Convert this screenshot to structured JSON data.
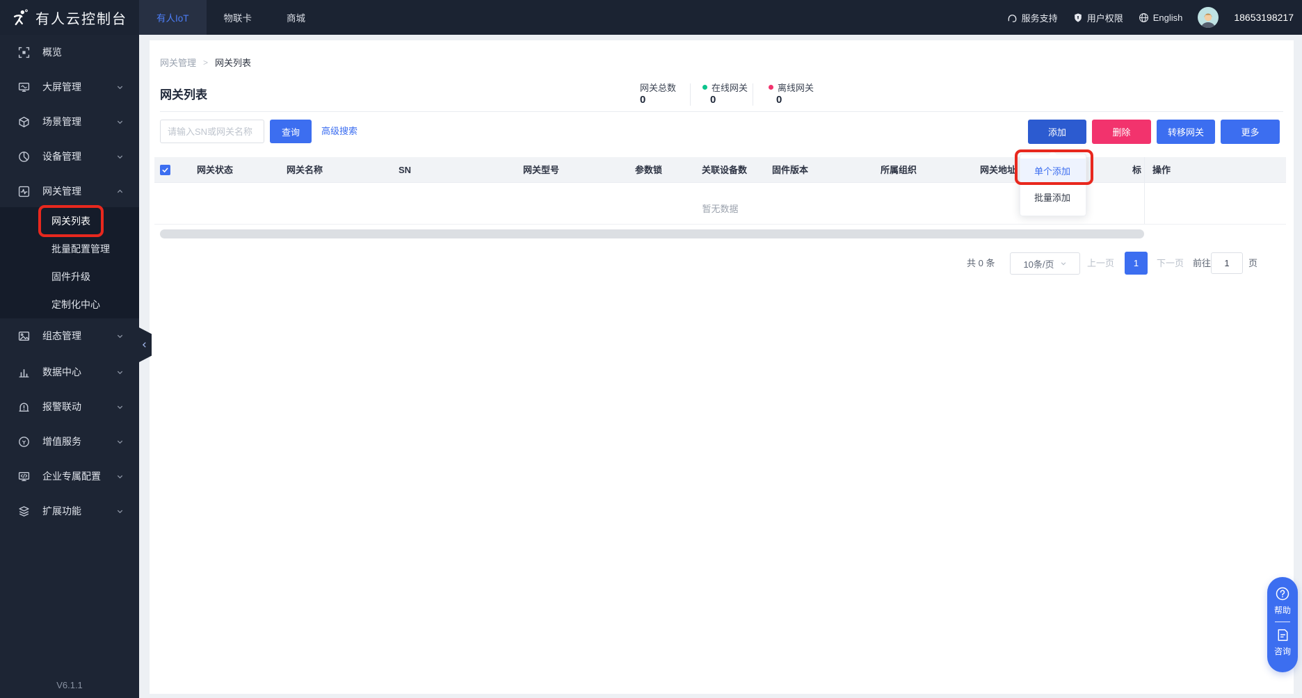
{
  "topbar": {
    "title": "有人云控制台",
    "tabs": {
      "iot": "有人IoT",
      "sim": "物联卡",
      "mall": "商城"
    },
    "support": "服务支持",
    "permission": "用户权限",
    "language": "English",
    "phone": "18653198217"
  },
  "sidebar": {
    "overview": "概览",
    "screen": "大屏管理",
    "scene": "场景管理",
    "device": "设备管理",
    "gateway": "网关管理",
    "gateway_sub": {
      "list": "网关列表",
      "batch": "批量配置管理",
      "firmware": "固件升级",
      "custom": "定制化中心"
    },
    "config": "组态管理",
    "data": "数据中心",
    "alarm": "报警联动",
    "value": "增值服务",
    "enterprise": "企业专属配置",
    "extension": "扩展功能",
    "version": "V6.1.1"
  },
  "breadcrumb": {
    "parent": "网关管理",
    "sep": ">",
    "current": "网关列表"
  },
  "page": {
    "title": "网关列表"
  },
  "stats": {
    "total_label": "网关总数",
    "total_value": "0",
    "online_label": "在线网关",
    "online_value": "0",
    "offline_label": "离线网关",
    "offline_value": "0"
  },
  "toolbar": {
    "search_placeholder": "请输入SN或网关名称",
    "query": "查询",
    "advanced": "高级搜索",
    "add": "添加",
    "delete": "删除",
    "transfer": "转移网关",
    "more": "更多"
  },
  "add_menu": {
    "single": "单个添加",
    "batch": "批量添加"
  },
  "table": {
    "col_status": "网关状态",
    "col_name": "网关名称",
    "col_sn": "SN",
    "col_model": "网关型号",
    "col_lock": "参数锁",
    "col_devices": "关联设备数",
    "col_firmware": "固件版本",
    "col_org": "所属组织",
    "col_address": "网关地址",
    "col_tag": "标",
    "col_action": "操作",
    "empty": "暂无数据"
  },
  "pagination": {
    "total": "共 0 条",
    "page_size": "10条/页",
    "prev": "上一页",
    "current": "1",
    "next": "下一页",
    "goto": "前往",
    "goto_value": "1",
    "unit": "页"
  },
  "floating": {
    "help": "帮助",
    "consult": "咨询"
  },
  "colors": {
    "accent_blue": "#3c6ef0",
    "add_button_active": "#2c5bd0",
    "danger_pink": "#f2336d",
    "online_dot": "#0bc48c",
    "offline_dot": "#f2336d",
    "annotation_red": "#e8281e",
    "topbar_bg": "#1b2332",
    "sidebar_bg": "#1d2534"
  }
}
